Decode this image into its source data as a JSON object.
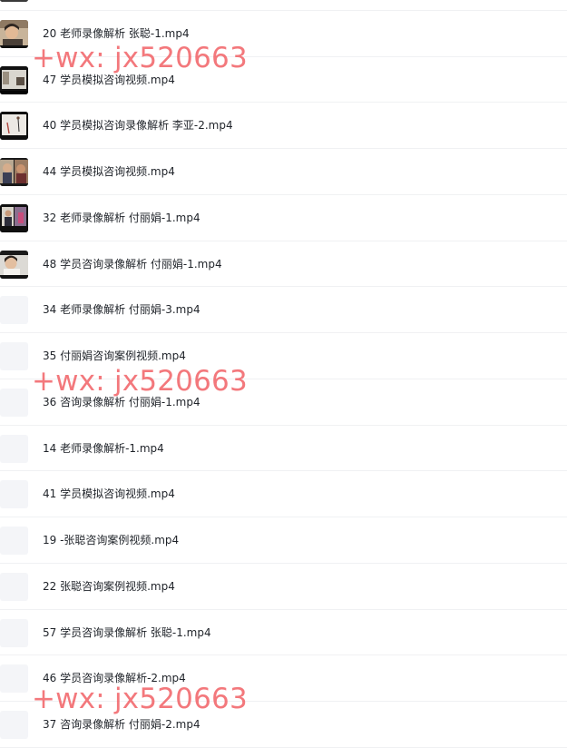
{
  "files": [
    {
      "name": "",
      "thumb": "video-dark"
    },
    {
      "name": "20 老师录像解析 张聪-1.mp4",
      "thumb": "video-woman-close"
    },
    {
      "name": "47 学员模拟咨询视频.mp4",
      "thumb": "video-dark-room"
    },
    {
      "name": "40 学员模拟咨询录像解析 李亚-2.mp4",
      "thumb": "video-figure"
    },
    {
      "name": "44 学员模拟咨询视频.mp4",
      "thumb": "video-split"
    },
    {
      "name": "32 老师录像解析 付丽娟-1.mp4",
      "thumb": "video-presenter"
    },
    {
      "name": "48 学员咨询录像解析 付丽娟-1.mp4",
      "thumb": "video-woman-white"
    },
    {
      "name": "34 老师录像解析 付丽娟-3.mp4",
      "thumb": "placeholder"
    },
    {
      "name": "35 付丽娟咨询案例视频.mp4",
      "thumb": "placeholder"
    },
    {
      "name": "36 咨询录像解析 付丽娟-1.mp4",
      "thumb": "placeholder"
    },
    {
      "name": "14 老师录像解析-1.mp4",
      "thumb": "placeholder"
    },
    {
      "name": "41 学员模拟咨询视频.mp4",
      "thumb": "placeholder"
    },
    {
      "name": "19 -张聪咨询案例视频.mp4",
      "thumb": "placeholder"
    },
    {
      "name": "22 张聪咨询案例视频.mp4",
      "thumb": "placeholder"
    },
    {
      "name": "57 学员咨询录像解析 张聪-1.mp4",
      "thumb": "placeholder"
    },
    {
      "name": "46 学员咨询录像解析-2.mp4",
      "thumb": "placeholder"
    },
    {
      "name": "37 咨询录像解析 付丽娟-2.mp4",
      "thumb": "placeholder"
    }
  ],
  "watermarks": [
    {
      "text": "+wx: jx520663"
    },
    {
      "text": "+wx: jx520663"
    },
    {
      "text": "+wx: jx520663"
    }
  ],
  "colors": {
    "watermark": "#f05a5f",
    "placeholder_thumb": "#f4f5f8",
    "divider": "#f0f1f3",
    "text": "#1f2329"
  }
}
